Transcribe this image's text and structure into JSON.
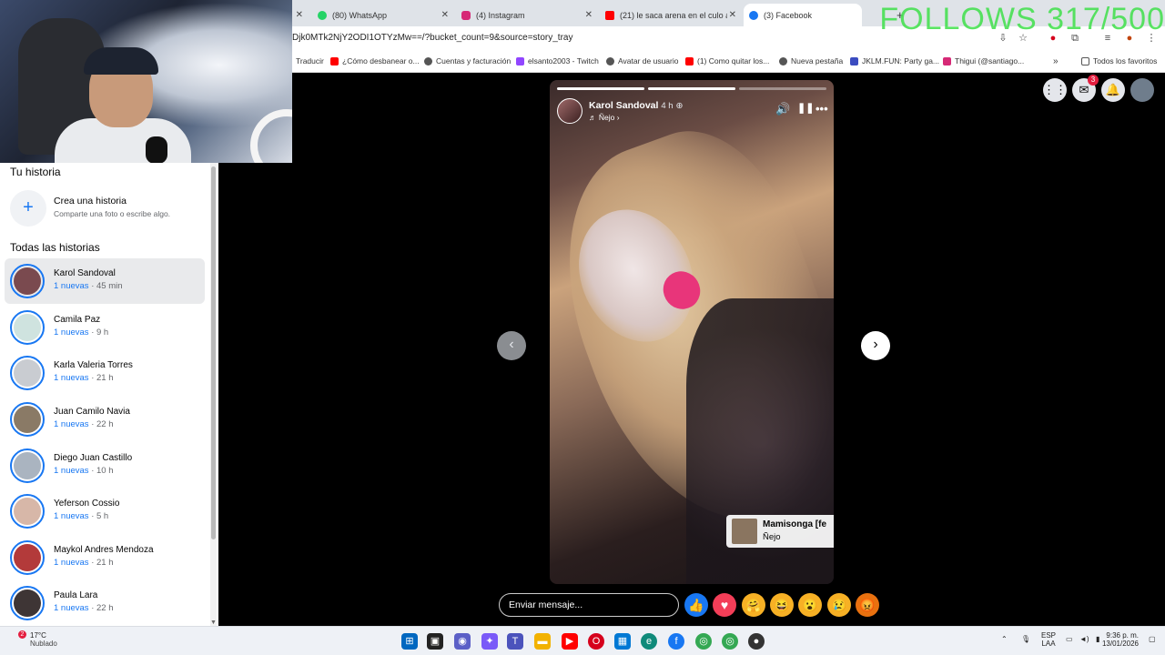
{
  "overlay": {
    "follows_text": "FOLLOWS 317/500"
  },
  "browser": {
    "tabs": [
      {
        "label": "(80) WhatsApp",
        "color": "#25d366"
      },
      {
        "label": "(4) Instagram",
        "color": "#d62976"
      },
      {
        "label": "(21) le saca arena en el culo a u",
        "color": "#ff0000"
      },
      {
        "label": "(3) Facebook",
        "color": "#1877f2"
      }
    ],
    "url": "Djk0MTk2NjY2ODI1OTYzMw==/?bucket_count=9&source=story_tray",
    "bookmarks": [
      {
        "label": "Traducir",
        "color": "#4285f4"
      },
      {
        "label": "¿Cómo desbanear o...",
        "color": "#ff0000"
      },
      {
        "label": "Cuentas y facturación",
        "color": "#333333"
      },
      {
        "label": "elsanto2003 - Twitch",
        "color": "#9146ff"
      },
      {
        "label": "Avatar de usuario",
        "color": "#333333"
      },
      {
        "label": "(1) Como quitar los...",
        "color": "#ff0000"
      },
      {
        "label": "Nueva pestaña",
        "color": "#333333"
      },
      {
        "label": "JKLM.FUN: Party ga...",
        "color": "#3b4cc0"
      },
      {
        "label": "Thigui (@santiago...",
        "color": "#d62976"
      }
    ],
    "bookmarks_all": "Todos los favoritos"
  },
  "sidebar": {
    "your_story_title": "Tu historia",
    "create_title": "Crea una historia",
    "create_subtitle": "Comparte una foto o escribe algo.",
    "all_stories_title": "Todas las historias",
    "new_label": "1 nuevas",
    "stories": [
      {
        "name": "Karol Sandoval",
        "time": " · 45 min",
        "color": "#7a4a4f"
      },
      {
        "name": "Camila Paz",
        "time": " · 9 h",
        "color": "#cfe3df"
      },
      {
        "name": "Karla Valeria Torres",
        "time": " · 21 h",
        "color": "#c9ccd1"
      },
      {
        "name": "Juan Camilo Navia",
        "time": " · 22 h",
        "color": "#8a7a66"
      },
      {
        "name": "Diego Juan Castillo",
        "time": " · 10 h",
        "color": "#aab4c0"
      },
      {
        "name": "Yeferson Cossio",
        "time": " · 5 h",
        "color": "#d7b7a8"
      },
      {
        "name": "Maykol Andres Mendoza",
        "time": " · 21 h",
        "color": "#b33a3a"
      },
      {
        "name": "Paula Lara",
        "time": " · 22 h",
        "color": "#3e3535"
      }
    ]
  },
  "story": {
    "author": "Karol Sandoval",
    "time": "4 h",
    "song": "♬ Ñejo ›",
    "music_title": "Mamisonga [fe",
    "music_artist": "Ñejo",
    "progress_segments": 3,
    "progress_done": 2
  },
  "topbar": {
    "messenger_badge": "3"
  },
  "reply": {
    "placeholder": "Enviar mensaje..."
  },
  "taskbar": {
    "weather_badge": "2",
    "temp": "17°C",
    "condition": "Nublado",
    "lang_1": "ESP",
    "lang_2": "LAA",
    "time": "9:36 p. m.",
    "date": "13/01/2026"
  }
}
